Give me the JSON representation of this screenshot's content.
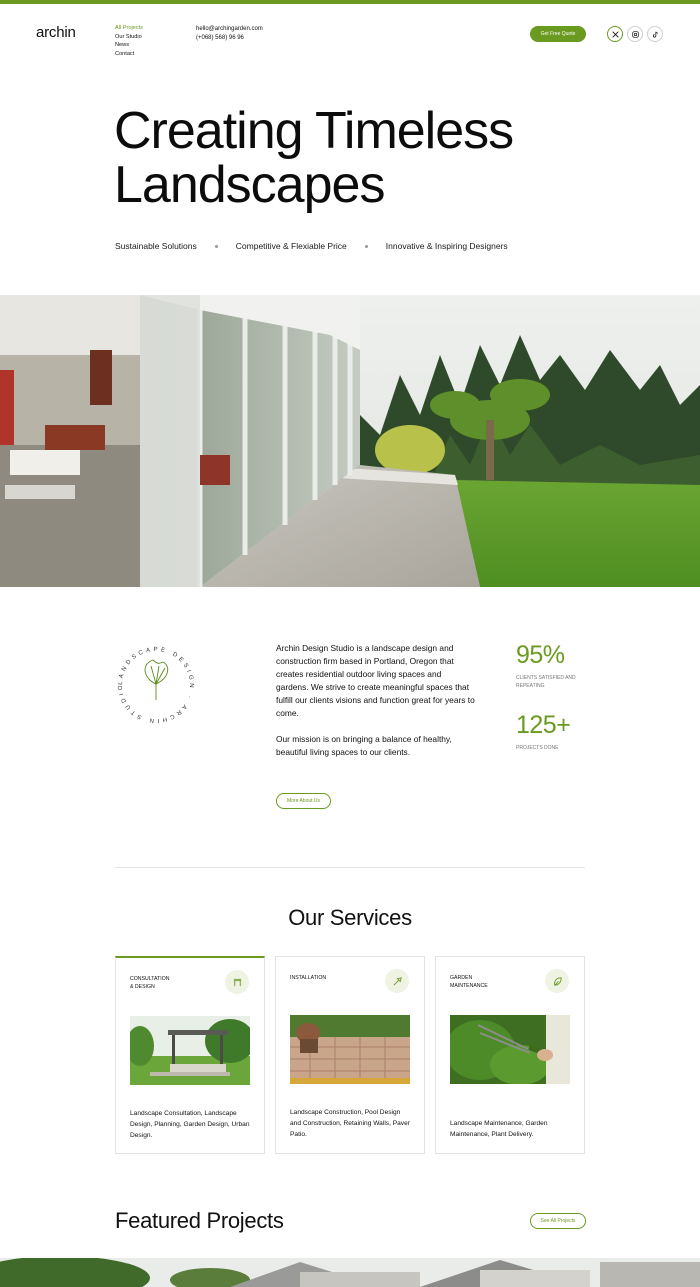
{
  "brand": {
    "logo": "archin",
    "accent": "#6a9a1f"
  },
  "nav": {
    "items": [
      {
        "label": "All Projects",
        "active": true
      },
      {
        "label": "Our Studio",
        "active": false
      },
      {
        "label": "News",
        "active": false
      },
      {
        "label": "Contact",
        "active": false
      }
    ]
  },
  "contact": {
    "email": "hello@archingarden.com",
    "phone": "(+068) 568) 96 96"
  },
  "header": {
    "quote_label": "Get Free Quote",
    "socials": [
      "x-icon",
      "instagram-icon",
      "tiktok-icon"
    ]
  },
  "hero": {
    "title_line1": "Creating Timeless",
    "title_line2": "Landscapes",
    "features": [
      "Sustainable Solutions",
      "Competitive  & Flexiable Price",
      "Innovative & Inspiring Designers"
    ]
  },
  "about": {
    "badge_text": "LANDSCAPE DESIGN · ARCHIN STUDIO ·",
    "paragraph1": "Archin Design Studio is a landscape design and construction firm based in Portland, Oregon that creates residential outdoor living spaces and gardens. We strive to create meaningful spaces that fulfill our clients visions and function great for years to come.",
    "paragraph2": "Our mission is on bringing a balance of healthy, beautiful living spaces to our clients.",
    "more_label": "More About Us",
    "stats": [
      {
        "value": "95%",
        "label": "CLIENTS SATISFIED AND REPEATING"
      },
      {
        "value": "125+",
        "label": "PROJECTS DONE"
      }
    ]
  },
  "services": {
    "title": "Our Services",
    "cards": [
      {
        "title_line1": "CONSULTATION",
        "title_line2": "& DESIGN",
        "icon": "pergola-icon",
        "description": "Landscape Consultation, Landscape Design, Planning, Garden Design, Urban Design."
      },
      {
        "title_line1": "INSTALLATION",
        "title_line2": "",
        "icon": "shovel-icon",
        "description": "Landscape Construction, Pool Design and Construction, Retaining Walls, Paver Patio."
      },
      {
        "title_line1": "GARDEN",
        "title_line2": "MAINTENANCE",
        "icon": "leaf-icon",
        "description": "Landscape Maintenance, Garden Maintenance, Plant Delivery."
      }
    ]
  },
  "featured": {
    "title": "Featured Projects",
    "see_all_label": "See All Projects"
  }
}
